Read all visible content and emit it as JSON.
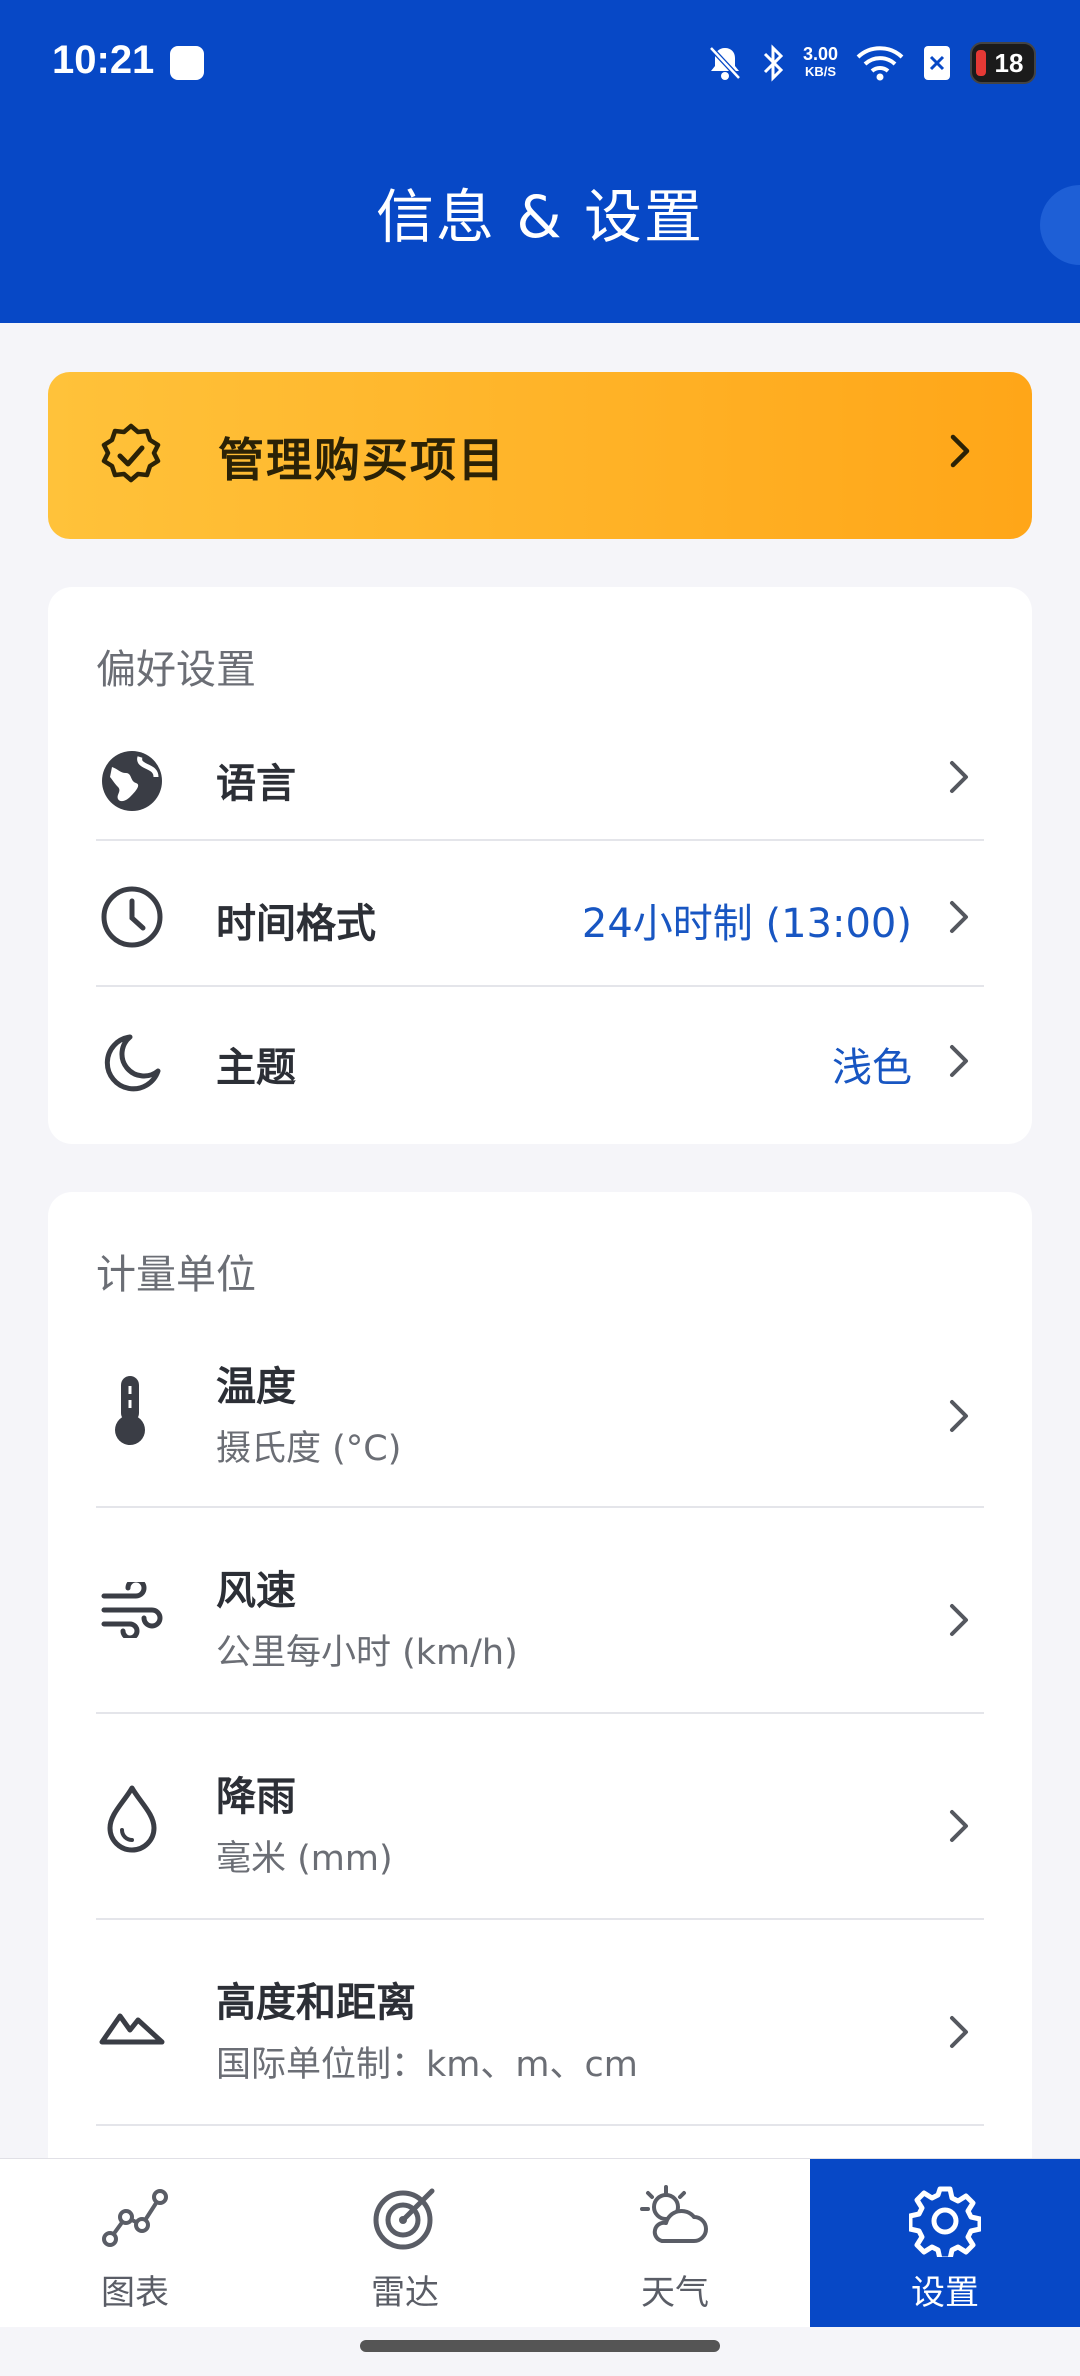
{
  "status_bar": {
    "time": "10:21",
    "net_speed_value": "3.00",
    "net_speed_unit": "KB/S",
    "battery": "18"
  },
  "header": {
    "title": "信息 & 设置"
  },
  "purchase": {
    "label": "管理购买项目"
  },
  "preferences": {
    "title": "偏好设置",
    "items": [
      {
        "label": "语言",
        "value": ""
      },
      {
        "label": "时间格式",
        "value": "24小时制 (13:00)"
      },
      {
        "label": "主题",
        "value": "浅色"
      }
    ]
  },
  "units": {
    "title": "计量单位",
    "items": [
      {
        "label": "温度",
        "sub": "摄氏度 (°C)"
      },
      {
        "label": "风速",
        "sub": "公里每小时 (km/h)"
      },
      {
        "label": "降雨",
        "sub": "毫米 (mm)"
      },
      {
        "label": "高度和距离",
        "sub": "国际单位制：km、m、cm"
      }
    ]
  },
  "nav": {
    "items": [
      {
        "label": "图表",
        "icon": "chart-icon"
      },
      {
        "label": "雷达",
        "icon": "radar-icon"
      },
      {
        "label": "天气",
        "icon": "weather-icon"
      },
      {
        "label": "设置",
        "icon": "gear-icon"
      }
    ],
    "active_index": 3
  },
  "colors": {
    "primary": "#0748c6",
    "accent_value": "#1856c2",
    "banner_start": "#ffc23a",
    "banner_end": "#ffa618"
  }
}
